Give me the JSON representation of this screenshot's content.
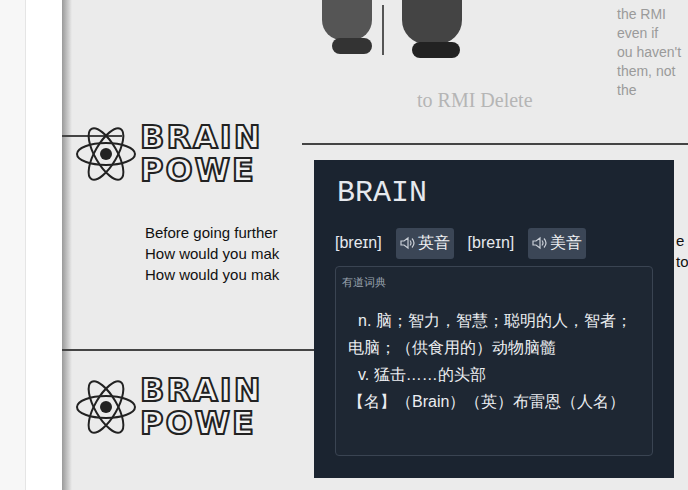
{
  "page": {
    "top_right_lines": [
      "the RMI",
      "even if",
      "ou haven't",
      "them, not the"
    ],
    "faded_heading": "to RMI Delete",
    "brain_power": [
      {
        "line1": "BRAIN",
        "line2": "POWE"
      },
      {
        "line1": "BRAIN",
        "line2": "POWE"
      }
    ],
    "paragraph_lines": [
      "Before going further",
      "How would you mak",
      "How would you mak"
    ],
    "right_edge_fragments": [
      "e",
      "to"
    ]
  },
  "popup": {
    "word": "BRAIN",
    "pronunciations": [
      {
        "phonetic": "[breɪn]",
        "button": "英音"
      },
      {
        "phonetic": "[breɪn]",
        "button": "美音"
      }
    ],
    "source": "有道词典",
    "definitions": [
      "n. 脑；智力，智慧；聪明的人，智者；电脑；（供食用的）动物脑髓",
      "v. 猛击……的头部",
      "【名】（Brain）（英）布雷恩（人名）"
    ]
  }
}
